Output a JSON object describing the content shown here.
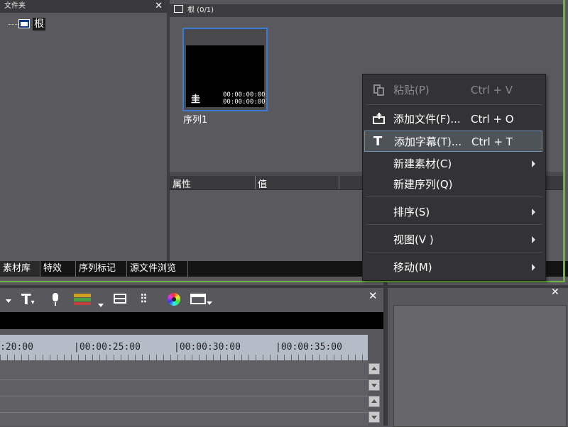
{
  "folder_panel": {
    "title": "文件夹",
    "root_label": "根"
  },
  "bin_panel": {
    "title": "根 (0/1)",
    "clip": {
      "name": "序列1",
      "timecode_in": "00:00:00:00",
      "timecode_out": "00:00:00:00"
    }
  },
  "properties": {
    "col_property": "属性",
    "col_value": "值"
  },
  "tabs": [
    "素材库",
    "特效",
    "序列标记",
    "源文件浏览"
  ],
  "context_menu": {
    "items": [
      {
        "label": "粘贴(P)",
        "shortcut": "Ctrl + V",
        "icon": "paste-icon",
        "disabled": true
      },
      {
        "label": "添加文件(F)...",
        "shortcut": "Ctrl + O",
        "icon": "add-file-icon"
      },
      {
        "label": "添加字幕(T)...",
        "shortcut": "Ctrl + T",
        "icon": "title-t-icon",
        "highlighted": true
      },
      {
        "label": "新建素材(C)",
        "submenu": true
      },
      {
        "label": "新建序列(Q)"
      },
      {
        "label": "排序(S)",
        "submenu": true
      },
      {
        "label": "视图(V )",
        "submenu": true
      },
      {
        "label": "移动(M)",
        "submenu": true
      }
    ]
  },
  "timeline": {
    "ruler": [
      ":20:00",
      "|00:00:25:00",
      "|00:00:30:00",
      "|00:00:35:00"
    ]
  },
  "colors": {
    "accent_green": "#6db33f",
    "selection_blue": "#3a7bd5",
    "menu_bg": "#333335"
  }
}
